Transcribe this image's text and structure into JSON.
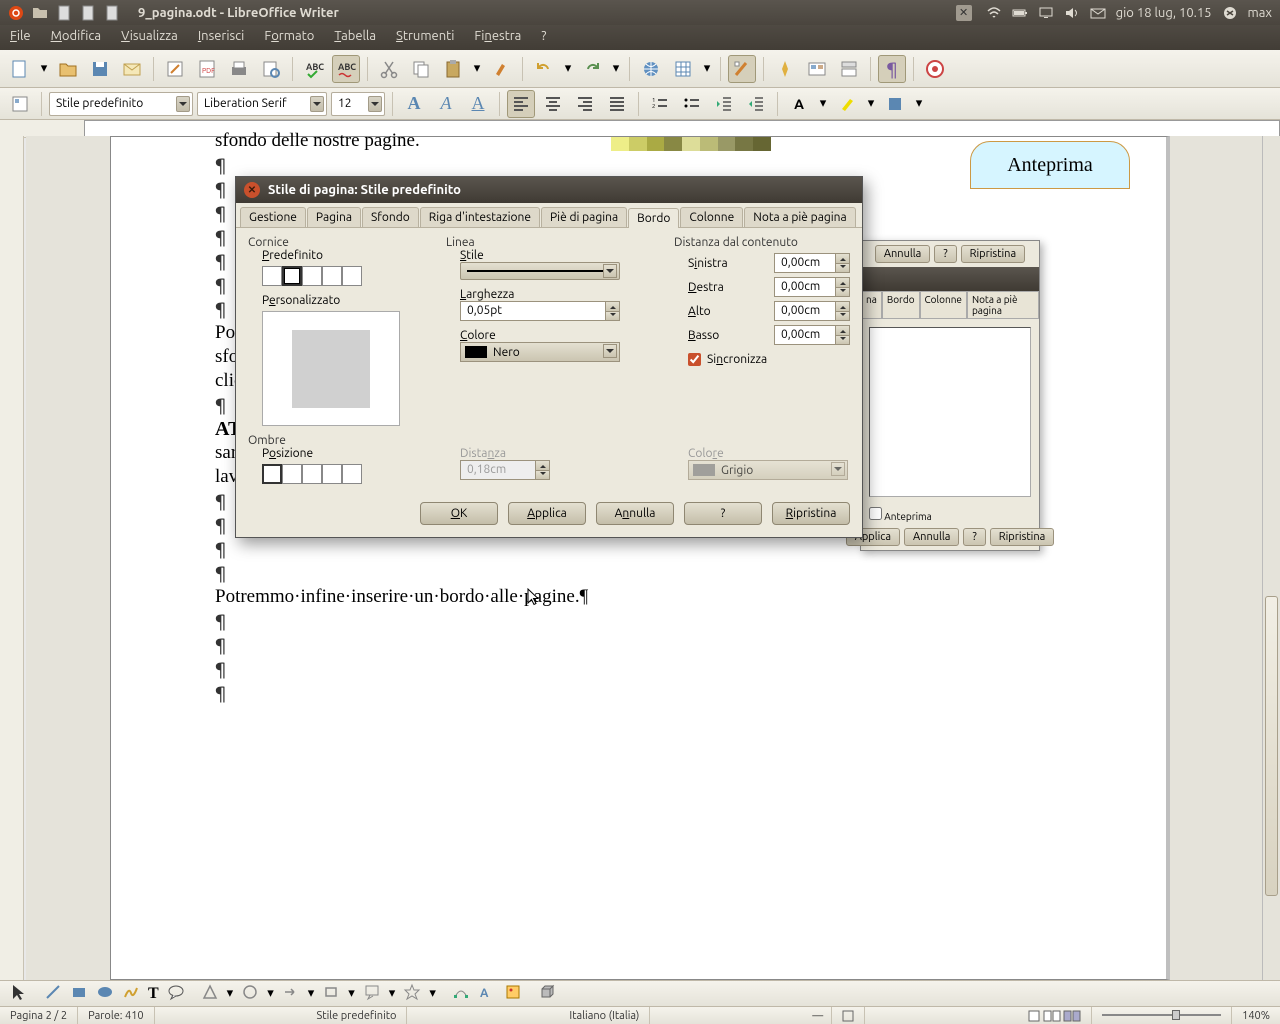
{
  "topbar": {
    "title": "9_pagina.odt - LibreOffice Writer",
    "clock": "gio 18 lug, 10.15",
    "user": "max"
  },
  "menubar": {
    "items": [
      "File",
      "Modifica",
      "Visualizza",
      "Inserisci",
      "Formato",
      "Tabella",
      "Strumenti",
      "Finestra",
      "?"
    ]
  },
  "format_toolbar": {
    "style": "Stile predefinito",
    "font": "Liberation Serif",
    "size": "12"
  },
  "document": {
    "clipped_line": "sfondo delle nostre pagine.",
    "line1": "Potre",
    "line2": "sfond",
    "line3": "clicca",
    "line4_bold": "ATTI",
    "line5": "saran",
    "line6": "lavora",
    "last_line": "Potremmo·infine·inserire·un·bordo·alle·pagine.¶",
    "anteprima": "Anteprima"
  },
  "dialog": {
    "title": "Stile di pagina: Stile predefinito",
    "tabs": [
      "Gestione",
      "Pagina",
      "Sfondo",
      "Riga d'intestazione",
      "Piè di pagina",
      "Bordo",
      "Colonne",
      "Nota a piè pagina"
    ],
    "active_tab": "Bordo",
    "cornice": {
      "title": "Cornice",
      "predefinito": "Predefinito",
      "personalizzato": "Personalizzato"
    },
    "linea": {
      "title": "Linea",
      "stile": "Stile",
      "larghezza": "Larghezza",
      "larghezza_val": "0,05pt",
      "colore": "Colore",
      "colore_val": "Nero"
    },
    "distanza": {
      "title": "Distanza dal contenuto",
      "sinistra": "Sinistra",
      "destra": "Destra",
      "alto": "Alto",
      "basso": "Basso",
      "val": "0,00cm",
      "sincronizza": "Sincronizza"
    },
    "ombre": {
      "title": "Ombre",
      "posizione": "Posizione",
      "distanza": "Distanza",
      "distanza_val": "0,18cm",
      "colore": "Colore",
      "colore_val": "Grigio"
    },
    "buttons": {
      "ok": "OK",
      "applica": "Applica",
      "annulla": "Annulla",
      "help": "?",
      "ripristina": "Ripristina"
    }
  },
  "bg_dialog": {
    "annulla": "Annulla",
    "help": "?",
    "ripristina": "Ripristina",
    "applica": "Applica",
    "tabs": [
      "na",
      "Bordo",
      "Colonne",
      "Nota a piè pagina"
    ],
    "anteprima": "Anteprima"
  },
  "statusbar": {
    "page": "Pagina 2 / 2",
    "words": "Parole: 410",
    "style": "Stile predefinito",
    "lang": "Italiano (Italia)",
    "zoom": "140%"
  }
}
